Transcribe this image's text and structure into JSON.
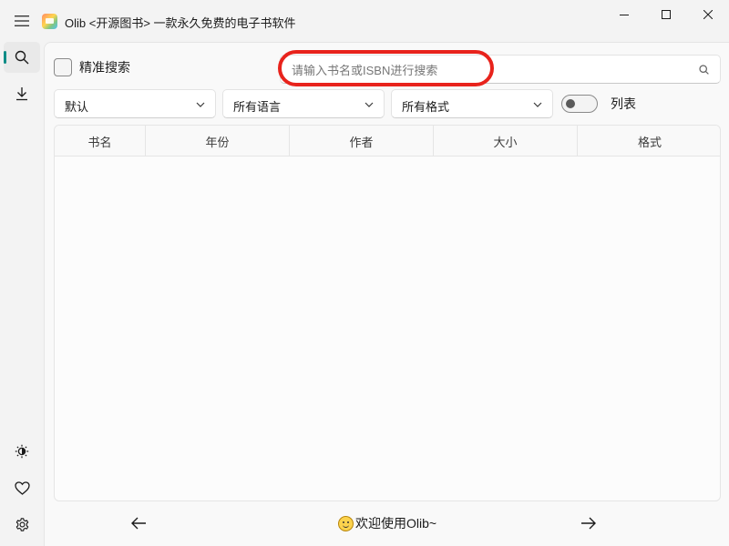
{
  "window": {
    "title": "Olib <开源图书> 一款永久免费的电子书软件"
  },
  "search": {
    "exact_label": "精准搜索",
    "placeholder": "请输入书名或ISBN进行搜索",
    "value": ""
  },
  "filters": {
    "sort": "默认",
    "language": "所有语言",
    "format": "所有格式",
    "list_toggle_label": "列表"
  },
  "table": {
    "columns": [
      "书名",
      "年份",
      "作者",
      "大小",
      "格式"
    ],
    "rows": []
  },
  "footer": {
    "welcome": "欢迎使用Olib~"
  },
  "colors": {
    "accent": "#0f8c86",
    "highlight": "#e8231c"
  },
  "icons": {
    "menu": "hamburger-icon",
    "search": "search-icon",
    "download": "download-icon",
    "theme": "brightness-icon",
    "favorite": "heart-icon",
    "settings": "gear-icon"
  }
}
